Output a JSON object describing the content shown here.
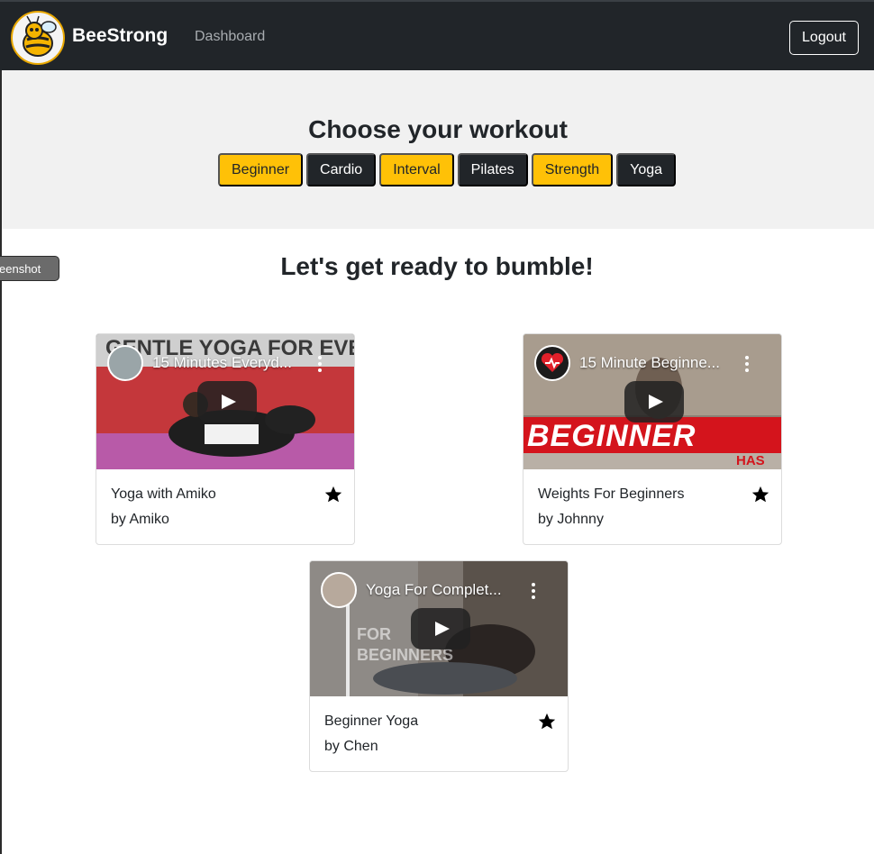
{
  "navbar": {
    "brand": "BeeStrong",
    "dashboard_link": "Dashboard",
    "logout_label": "Logout",
    "logo_icon": "bee-logo-icon"
  },
  "hero": {
    "title": "Choose your workout",
    "filters": [
      {
        "label": "Beginner",
        "style": "warning"
      },
      {
        "label": "Cardio",
        "style": "dark"
      },
      {
        "label": "Interval",
        "style": "warning"
      },
      {
        "label": "Pilates",
        "style": "dark"
      },
      {
        "label": "Strength",
        "style": "warning"
      },
      {
        "label": "Yoga",
        "style": "dark"
      }
    ]
  },
  "screenshot_tab": "eenshot",
  "section": {
    "title": "Let's get ready to bumble!"
  },
  "cards": [
    {
      "video_title": "15 Minutes Everyd...",
      "title": "Yoga with Amiko",
      "author": "by Amiko",
      "favorite_icon": "star-icon",
      "thumb_text": "GENTLE YOGA FOR EVERYONE"
    },
    {
      "video_title": "15 Minute Beginne...",
      "title": "Weights For Beginners",
      "author": "by Johnny",
      "favorite_icon": "star-icon",
      "thumb_text": "BEGINNER",
      "thumb_text_small": "HAS"
    },
    {
      "video_title": "Yoga For Complet...",
      "title": "Beginner Yoga",
      "author": "by Chen",
      "favorite_icon": "star-icon",
      "thumb_text": "FOR BEGINNERS"
    }
  ],
  "colors": {
    "navbar_bg": "#212529",
    "accent_warning": "#ffc107",
    "hero_bg": "#f1f1f1"
  }
}
